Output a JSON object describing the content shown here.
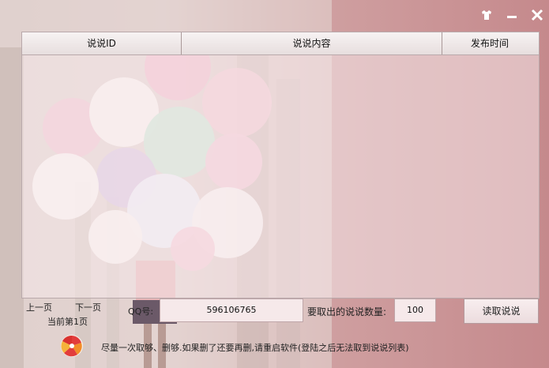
{
  "window": {
    "controls": [
      {
        "icon": "shirt-icon"
      },
      {
        "icon": "minimize-icon"
      },
      {
        "icon": "close-icon"
      }
    ]
  },
  "list": {
    "columns": [
      "说说ID",
      "说说内容",
      "发布时间"
    ],
    "rows": []
  },
  "pager": {
    "prev": "上一页",
    "next": "下一页",
    "current": "当前第1页"
  },
  "form": {
    "qq_label": "QQ号:",
    "qq_value": "596106765",
    "count_label": "要取出的说说数量:",
    "count_value": "100",
    "read_button": "读取说说"
  },
  "notice": "尽量一次取够、删够.如果删了还要再删,请重启软件(登陆之后无法取到说说列表)"
}
